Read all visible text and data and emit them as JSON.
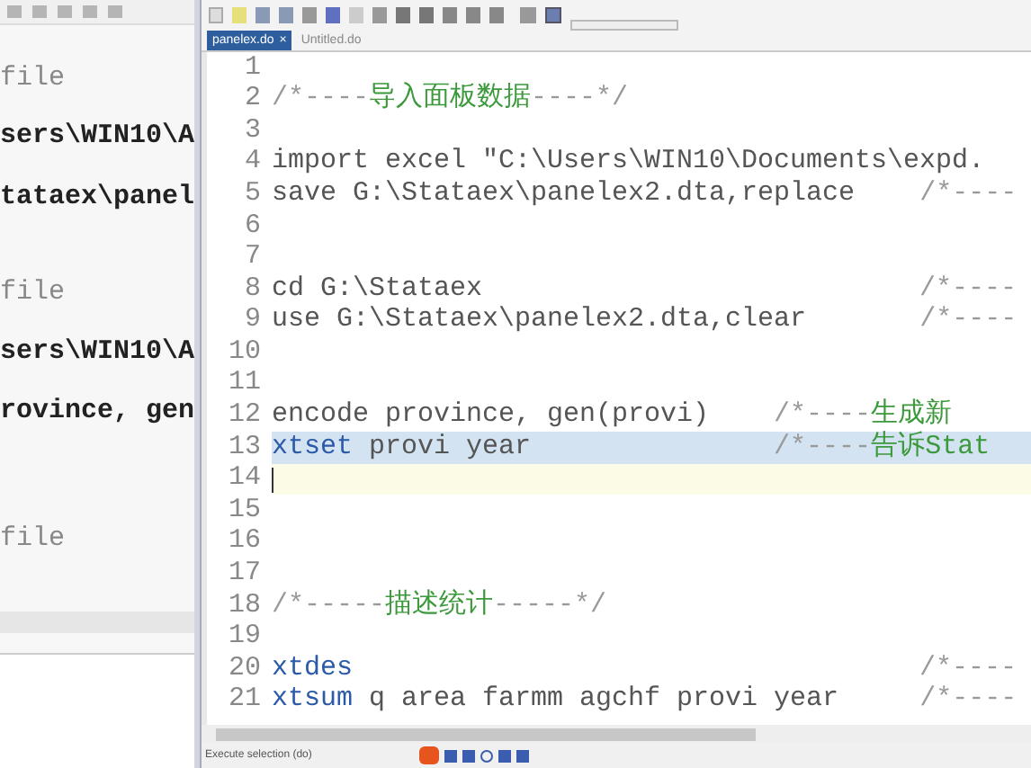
{
  "results_pane": {
    "lines": [
      {
        "kind": "echo",
        "text": "file"
      },
      {
        "kind": "bold",
        "text": "sers\\WIN10\\A"
      },
      {
        "kind": "bold",
        "text": "tataex\\panel"
      },
      {
        "kind": "echo",
        "text": "file"
      },
      {
        "kind": "bold",
        "text": "sers\\WIN10\\A"
      },
      {
        "kind": "bold",
        "text": "rovince, gen"
      },
      {
        "kind": "echo",
        "text": "file"
      }
    ]
  },
  "editor": {
    "tabs": [
      {
        "label": "panelex.do",
        "selected": true,
        "close": "×"
      },
      {
        "label": "Untitled.do",
        "selected": false
      }
    ],
    "lines": [
      {
        "number": "1",
        "selected": false,
        "cursor": false
      },
      {
        "number": "2",
        "selected": false,
        "cursor": false,
        "segments": [
          {
            "kind": "comment",
            "text": "/*----"
          },
          {
            "kind": "comment_cn",
            "text": "导入面板数据"
          },
          {
            "kind": "comment",
            "text": "----*/"
          }
        ]
      },
      {
        "number": "3",
        "selected": false,
        "cursor": false
      },
      {
        "number": "4",
        "selected": false,
        "cursor": false,
        "segments": [
          {
            "kind": "text",
            "text": "import excel \"C:\\Users\\WIN10\\Documents\\expd."
          }
        ]
      },
      {
        "number": "5",
        "selected": false,
        "cursor": false,
        "segments": [
          {
            "kind": "text",
            "text": "save G:\\Stataex\\panelex2.dta,replace"
          },
          {
            "kind": "far_comment",
            "text": "/*----"
          }
        ]
      },
      {
        "number": "6",
        "selected": false,
        "cursor": false
      },
      {
        "number": "7",
        "selected": false,
        "cursor": false
      },
      {
        "number": "8",
        "selected": false,
        "cursor": false,
        "segments": [
          {
            "kind": "text",
            "text": "cd G:\\Stataex"
          },
          {
            "kind": "far_comment",
            "text": "/*----"
          }
        ]
      },
      {
        "number": "9",
        "selected": false,
        "cursor": false,
        "segments": [
          {
            "kind": "text",
            "text": "use G:\\Stataex\\panelex2.dta,clear"
          },
          {
            "kind": "far_comment",
            "text": "/*----"
          }
        ]
      },
      {
        "number": "10",
        "selected": false,
        "cursor": false
      },
      {
        "number": "11",
        "selected": false,
        "cursor": false
      },
      {
        "number": "12",
        "selected": false,
        "cursor": false,
        "segments": [
          {
            "kind": "text",
            "text": "encode province, gen(provi)"
          },
          {
            "kind": "near_comment",
            "text": "/*----"
          },
          {
            "kind": "comment_cn",
            "text": "生成新"
          }
        ]
      },
      {
        "number": "13",
        "selected": true,
        "cursor": false,
        "segments": [
          {
            "kind": "command",
            "text": "xtset"
          },
          {
            "kind": "text",
            "text": " provi year"
          },
          {
            "kind": "near_comment",
            "text": "/*----"
          },
          {
            "kind": "comment_cn",
            "text": "告诉Stat"
          }
        ]
      },
      {
        "number": "14",
        "selected": false,
        "cursor": true
      },
      {
        "number": "15",
        "selected": false,
        "cursor": false
      },
      {
        "number": "16",
        "selected": false,
        "cursor": false
      },
      {
        "number": "17",
        "selected": false,
        "cursor": false
      },
      {
        "number": "18",
        "selected": false,
        "cursor": false,
        "segments": [
          {
            "kind": "comment",
            "text": "/*-----"
          },
          {
            "kind": "comment_cn",
            "text": "描述统计"
          },
          {
            "kind": "comment",
            "text": "-----*/"
          }
        ]
      },
      {
        "number": "19",
        "selected": false,
        "cursor": false
      },
      {
        "number": "20",
        "selected": false,
        "cursor": false,
        "segments": [
          {
            "kind": "command",
            "text": "xtdes"
          },
          {
            "kind": "far_comment",
            "text": "/*----"
          }
        ]
      },
      {
        "number": "21",
        "selected": false,
        "cursor": false,
        "segments": [
          {
            "kind": "command",
            "text": "xtsum"
          },
          {
            "kind": "text",
            "text": " q area farmm agchf provi year"
          },
          {
            "kind": "far_comment",
            "text": "/*----"
          }
        ]
      }
    ]
  },
  "status_bar": {
    "text": "Execute selection (do)"
  }
}
